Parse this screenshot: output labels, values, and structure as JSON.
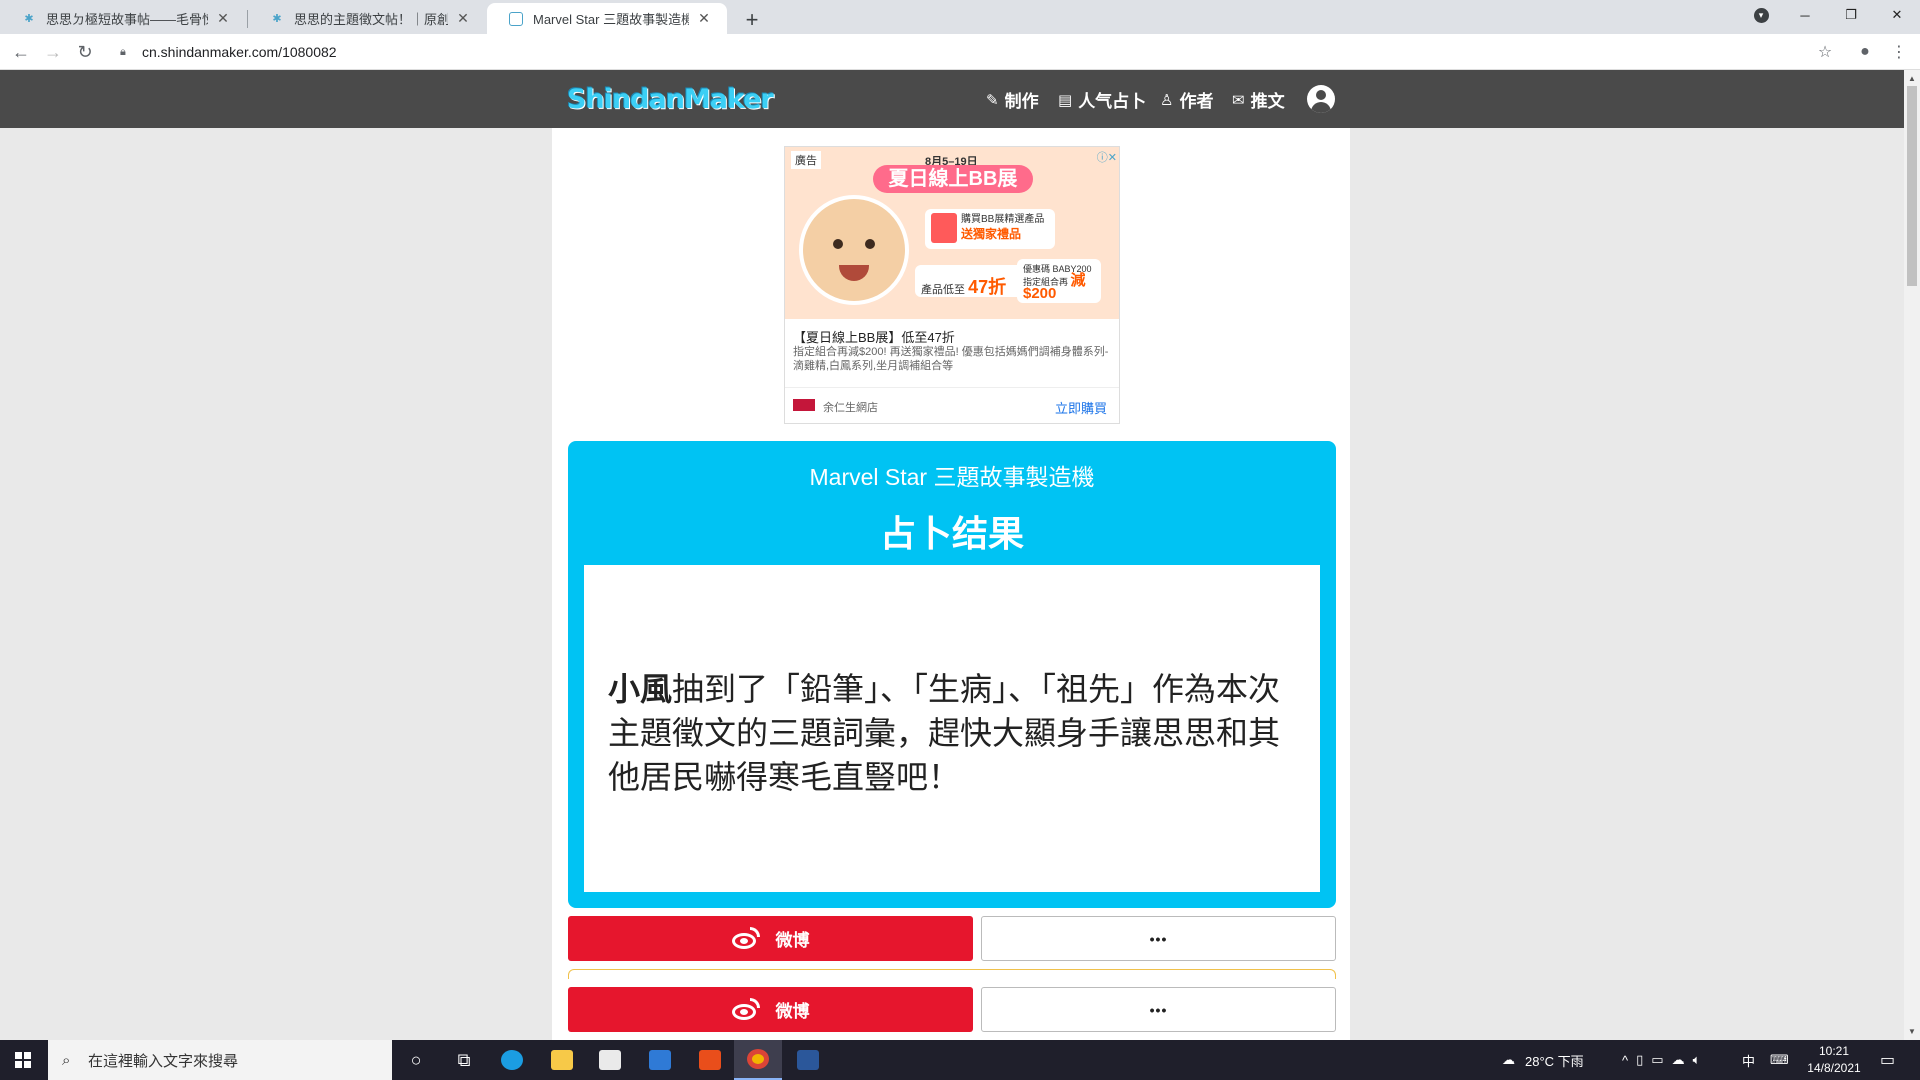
{
  "browser": {
    "tabs": [
      {
        "label": "思思ㄉ極短故事帖——毛骨悚然",
        "active": false
      },
      {
        "label": "思思的主題徵文帖！｜原創星球",
        "active": false
      },
      {
        "label": "Marvel Star 三題故事製造機",
        "active": true
      }
    ],
    "url": "cn.shindanmaker.com/1080082"
  },
  "site": {
    "logo": "ShindanMaker",
    "nav": [
      {
        "icon": "edit-icon",
        "glyph": "✎",
        "label": "制作"
      },
      {
        "icon": "list-icon",
        "glyph": "▤",
        "label": "人气占卜"
      },
      {
        "icon": "person-icon",
        "glyph": "♙",
        "label": "作者"
      },
      {
        "icon": "chat-icon",
        "glyph": "✉",
        "label": "推文"
      }
    ]
  },
  "ad": {
    "badge": "廣告",
    "date": "8月5–19日",
    "headline": "夏日線上BB展",
    "gift_text": "購買BB展精選產品",
    "gift_bold": "送獨家禮品",
    "discount_prefix": "產品低至",
    "discount_value": "47折",
    "coupon_code_label": "優惠碼",
    "coupon_code": "BABY200",
    "coupon_prefix": "指定組合再",
    "coupon_value": "減$200",
    "title": "【夏日線上BB展】低至47折",
    "description": "指定組合再減$200! 再送獨家禮品! 優惠包括媽媽們調補身體系列- 滴雞精,白鳳系列,坐月調補組合等",
    "store": "余仁生網店",
    "cta": "立即購買"
  },
  "result": {
    "title": "Marvel Star 三題故事製造機",
    "heading": "占卜结果",
    "name": "小風",
    "text": "抽到了「鉛筆」、「生病」、「祖先」作為本次主題徵文的三題詞彙，趕快大顯身手讓思思和其他居民嚇得寒毛直豎吧！"
  },
  "share": {
    "weibo_label": "微博",
    "more_label": "•••"
  },
  "taskbar": {
    "search_placeholder": "在這裡輸入文字來搜尋",
    "weather": "28°C 下雨",
    "ime": "中",
    "time": "10:21",
    "date": "14/8/2021"
  },
  "colors": {
    "accent": "#00c3f3",
    "weibo": "#e6162d",
    "header": "#4a4a4a"
  }
}
